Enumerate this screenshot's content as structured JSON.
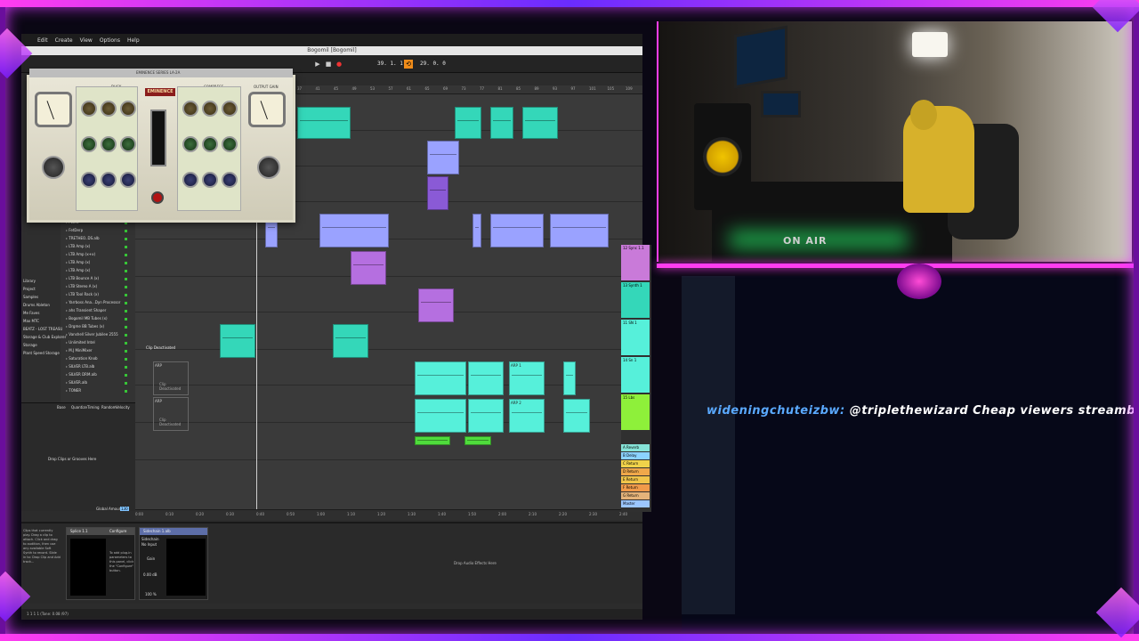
{
  "daw": {
    "menu": [
      "Edit",
      "Create",
      "View",
      "Options",
      "Help"
    ],
    "title": "Bogomil [Bogomil]",
    "transport": {
      "position": "39. 1. 1",
      "loop": "29. 0. 0"
    },
    "browser": {
      "categories": [
        "Library",
        "Project",
        "Samples",
        "Drums Ableton",
        "Me Faves",
        "Max MTC",
        "BEATZ - LOST TREASU",
        "Storage & Club Explorer",
        "Storage",
        "Plant Speed Storage"
      ],
      "devices": [
        "FLOW",
        "FetDerp",
        "TRETHEO..DS.alb",
        "LTB Amp (x)",
        "LTB Amp (x+x)",
        "LTB Amp (x)",
        "LTB Amp (x)",
        "LTB Bounce A (x)",
        "LTB Stereo A (x)",
        "LTB Tool Rack (x)",
        "Yarrboss Ana...Dyn Processor",
        "ahs Transient Shaper",
        "Bogomil MB Tubes (x)",
        "Drgme BB Tubes (x)",
        "Vanshell Silver Jubilee 2555",
        "Unlimited Intel",
        "M.J MiniMixer",
        "Saturation Knob",
        "SILVER LTB.alb",
        "SILVER DRM.alb",
        "SILVER.alb",
        "TONER"
      ]
    },
    "groove": {
      "headers": [
        "Base",
        "Quantize",
        "Timing",
        "Random",
        "Velocity"
      ],
      "drop_text": "Drop Clips or Grooves Here",
      "footer": "Global Amount",
      "amount": "130"
    },
    "arrangement": {
      "beats": [
        "37",
        "41",
        "45",
        "49",
        "53",
        "57",
        "61",
        "65",
        "69",
        "73",
        "77",
        "81",
        "85",
        "89",
        "93",
        "97",
        "101",
        "105",
        "109"
      ],
      "times": [
        "0:00",
        "0:10",
        "0:20",
        "0:30",
        "0:40",
        "0:50",
        "1:00",
        "1:10",
        "1:20",
        "1:30",
        "1:40",
        "1:50",
        "2:00",
        "2:10",
        "2:20",
        "2:30",
        "2:40",
        "2:50",
        "3:00",
        "3:10",
        "3:20"
      ],
      "clip_labels": {
        "deactivated": "Clip Deactivated",
        "arp": "ARP",
        "arp1": "ARP 1",
        "arp2": "ARP 2"
      }
    },
    "devices": {
      "info_text": "Clips that currently play. Drag a clip to attach. Click and drag to audition, then use any available Soft Synth to record. Slide in to: Drop Clip and Add track...",
      "splice": {
        "name": "Splice 1.1",
        "configure": "Configure",
        "hint": "To add plug-in parameters to this panel, click the \"Configure\" button."
      },
      "sidechain": {
        "name": "Sidechain 1.alb",
        "label": "Sidechain",
        "input": "No Input",
        "gain": "Gain",
        "gain_val": "0.00 dB",
        "dry_wet": "100 %"
      },
      "drop_text": "Drop Audio Effects Here"
    },
    "status": "1 1 1 1 (Tone: 0.08 /97)",
    "mixer_tracks": [
      {
        "label": "12 Sync 1.1",
        "color": "#c97ad9"
      },
      {
        "label": "13 Synth 1",
        "color": "#34d7b9"
      },
      {
        "label": "11 SN 1",
        "color": "#56f0da"
      },
      {
        "label": "14 Sn 1",
        "color": "#56f0da"
      },
      {
        "label": "15 Lbs",
        "color": "#8ef03a"
      },
      {
        "label": "A Reverb",
        "color": "#86e3d7"
      },
      {
        "label": "B Delay",
        "color": "#8bd3ff"
      },
      {
        "label": "C Return",
        "color": "#f0d24a"
      },
      {
        "label": "D Return",
        "color": "#f0a84a"
      },
      {
        "label": "E Return",
        "color": "#f0c44a"
      },
      {
        "label": "F Return",
        "color": "#f09a4a"
      },
      {
        "label": "G Return",
        "color": "#e4b37a"
      },
      {
        "label": "Master",
        "color": "#9cc6ff"
      }
    ]
  },
  "plugin": {
    "title": "EMINENCE SERIES LA-2A",
    "brand": "EMINENCE",
    "sections": [
      "DUCK",
      "COMPRESS",
      "OUTPUT GAIN"
    ]
  },
  "webcam": {
    "sign": "ON AIR"
  },
  "chat": {
    "user": "wideningchuteizbw:",
    "message": "@triplethewizard Cheap viewers streamboo .com (r"
  },
  "colors": {
    "frame": "#6a0e9c",
    "neon": "#ff3df0",
    "teal": "#34d7b9",
    "lavender": "#9aa2ff",
    "purple": "#b56fe0",
    "cyan": "#56f0da",
    "green": "#4fdc3c"
  }
}
